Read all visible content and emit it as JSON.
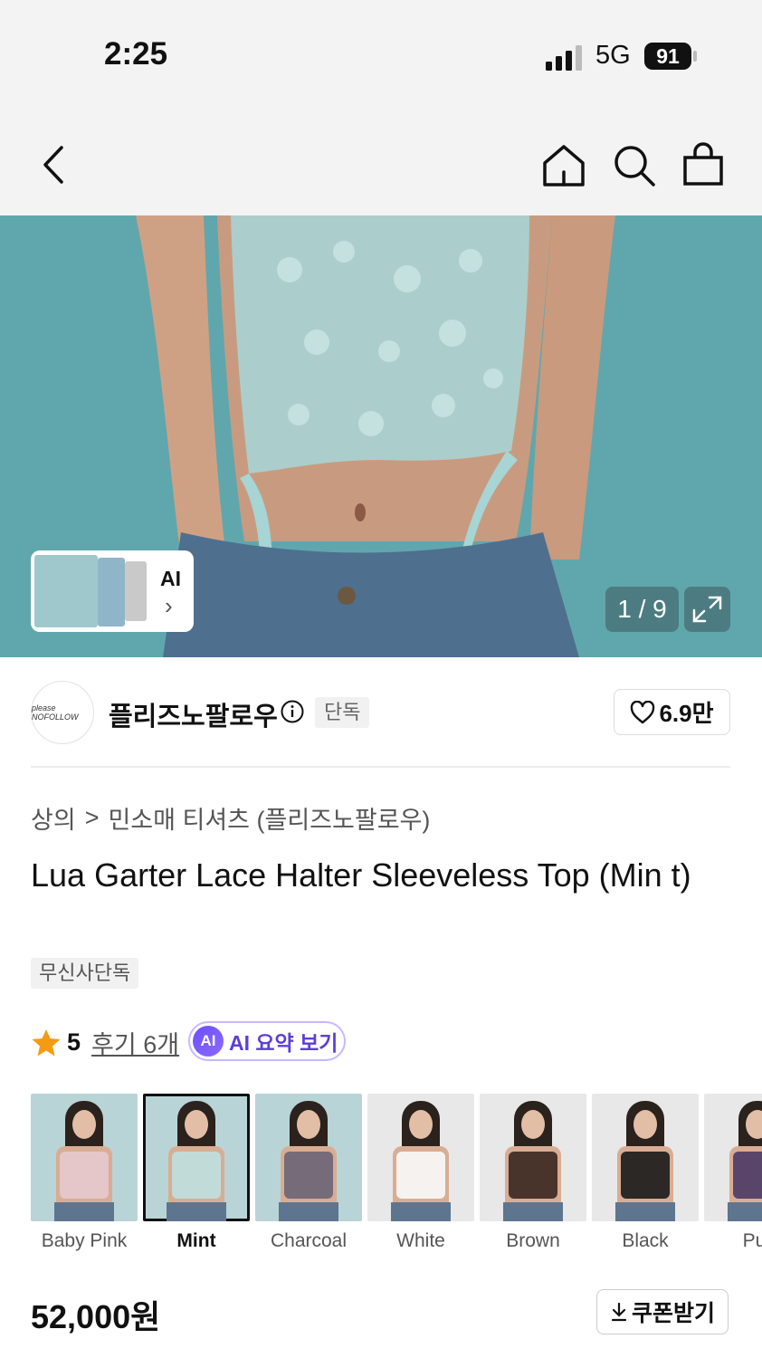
{
  "status_bar": {
    "time": "2:25",
    "network": "5G",
    "battery": "91"
  },
  "nav": {
    "back": "back",
    "home": "home",
    "search": "search",
    "bag": "shopping-bag"
  },
  "hero": {
    "pager": "1 / 9",
    "ai_thumb_label": "AI",
    "ai_thumb_arrow": "›"
  },
  "brand": {
    "logo_text": "please NOFOLLOW",
    "name": "플리즈노팔로우",
    "exclusive": "단독",
    "likes": "6.9만"
  },
  "breadcrumb": {
    "category": "상의",
    "separator": ">",
    "subcategory": "민소매 티셔츠 (플리즈노팔로우)"
  },
  "product": {
    "title": "Lua Garter Lace Halter Sleeveless Top (Min t)",
    "tag": "무신사단독"
  },
  "rating": {
    "score": "5",
    "reviews": "후기 6개",
    "ai_summary": "AI 요약 보기",
    "ai_badge": "AI"
  },
  "colors": [
    {
      "label": "Baby Pink",
      "bg": "#b9d4d6",
      "top": "#e7c9cf",
      "selected": false
    },
    {
      "label": "Mint",
      "bg": "#b9d4d6",
      "top": "#bfe0e0",
      "selected": true
    },
    {
      "label": "Charcoal",
      "bg": "#b9d4d6",
      "top": "#6b6475",
      "selected": false
    },
    {
      "label": "White",
      "bg": "#e8e8e8",
      "top": "#fafafa",
      "selected": false
    },
    {
      "label": "Brown",
      "bg": "#e8e8e8",
      "top": "#3a2721",
      "selected": false
    },
    {
      "label": "Black",
      "bg": "#e8e8e8",
      "top": "#1a1a1a",
      "selected": false
    },
    {
      "label": "Pur",
      "bg": "#e8e8e8",
      "top": "#4d3a66",
      "selected": false
    }
  ],
  "price": {
    "value": "52,000원",
    "coupon": "쿠폰받기"
  }
}
